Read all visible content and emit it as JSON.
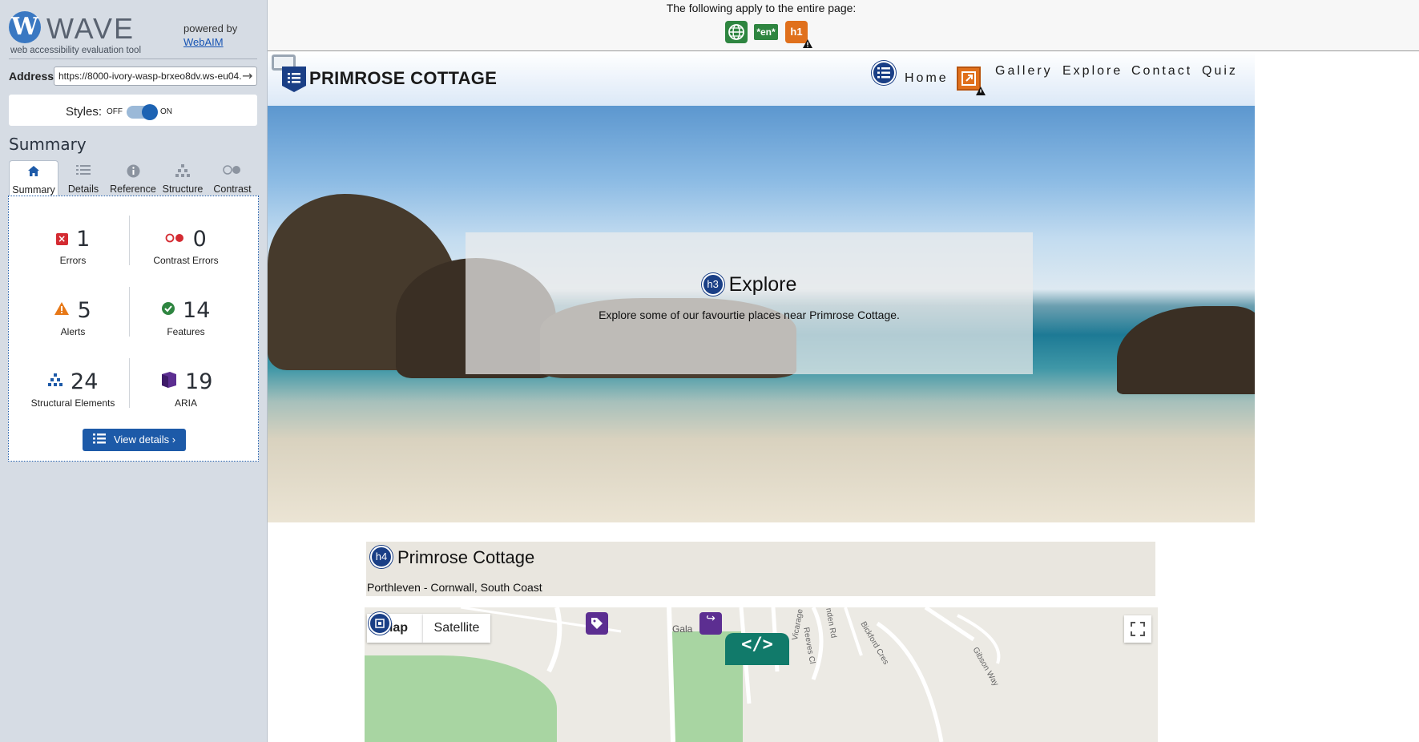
{
  "wave": {
    "logo_letter": "W",
    "logo_word": "WAVE",
    "tagline": "web accessibility evaluation tool",
    "powered_by": "powered by",
    "webaim_link": "WebAIM",
    "address_label": "Address:",
    "address_value": "https://8000-ivory-wasp-brxeo8dv.ws-eu04.",
    "styles_label": "Styles:",
    "styles_off": "OFF",
    "styles_on": "ON",
    "summary_heading": "Summary",
    "tabs": [
      {
        "label": "Summary",
        "icon": "home-icon"
      },
      {
        "label": "Details",
        "icon": "list-icon"
      },
      {
        "label": "Reference",
        "icon": "info-icon"
      },
      {
        "label": "Structure",
        "icon": "structure-icon"
      },
      {
        "label": "Contrast",
        "icon": "contrast-icon"
      }
    ],
    "stats": {
      "errors": {
        "count": "1",
        "label": "Errors"
      },
      "contrast": {
        "count": "0",
        "label": "Contrast Errors"
      },
      "alerts": {
        "count": "5",
        "label": "Alerts"
      },
      "features": {
        "count": "14",
        "label": "Features"
      },
      "structural": {
        "count": "24",
        "label": "Structural Elements"
      },
      "aria": {
        "count": "19",
        "label": "ARIA"
      }
    },
    "view_details": "View details ›",
    "colors": {
      "primary": "#1d5aa8",
      "error": "#d42b32",
      "alert": "#e77817",
      "feature": "#2e8540",
      "aria": "#5c2e91"
    }
  },
  "applybar": {
    "text": "The following apply to the entire page:",
    "lang_badge": "*en*",
    "h1_badge": "h1"
  },
  "site": {
    "brand": "PRIMROSE COTTAGE",
    "nav": [
      "Home",
      "Gallery",
      "Explore",
      "Contact",
      "Quiz"
    ],
    "hero_badge": "h3",
    "hero_title": "Explore",
    "hero_subtitle": "Explore some of our favourtie places near Primrose Cottage.",
    "card_badge": "h4",
    "card_title": "Primrose Cottage",
    "card_subtitle": "Porthleven - Cornwall, South Coast",
    "map": {
      "map_button": "Map",
      "satellite_button": "Satellite",
      "labels": [
        "Gala",
        "Reeves Cl",
        "Vicarage Rd",
        "Bickford Cres",
        "Gibson Way",
        "nden Rd"
      ]
    }
  }
}
